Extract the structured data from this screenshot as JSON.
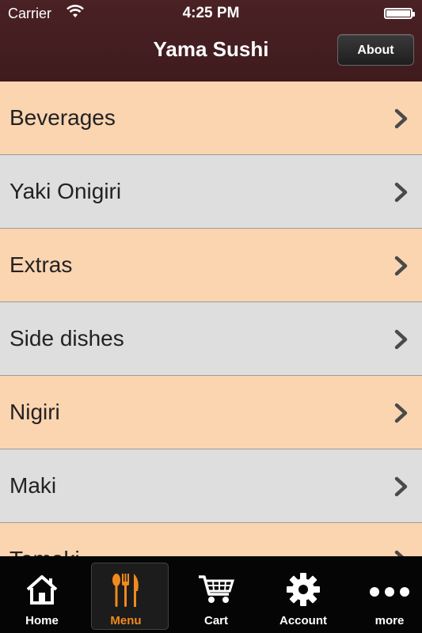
{
  "status": {
    "carrier": "Carrier",
    "time": "4:25 PM"
  },
  "nav": {
    "title": "Yama Sushi",
    "about_label": "About"
  },
  "colors": {
    "header": "#4a2124",
    "peach": "#fbd4b0",
    "gray": "#dedede",
    "accent": "#f08a1d"
  },
  "menu": {
    "items": [
      {
        "label": "Beverages"
      },
      {
        "label": "Yaki Onigiri"
      },
      {
        "label": "Extras"
      },
      {
        "label": "Side dishes"
      },
      {
        "label": "Nigiri"
      },
      {
        "label": "Maki"
      },
      {
        "label": "Temaki"
      }
    ]
  },
  "tabbar": {
    "tabs": [
      {
        "label": "Home",
        "icon": "home-icon"
      },
      {
        "label": "Menu",
        "icon": "cutlery-icon",
        "active": true
      },
      {
        "label": "Cart",
        "icon": "cart-icon"
      },
      {
        "label": "Account",
        "icon": "gear-icon"
      },
      {
        "label": "more",
        "icon": "more-icon"
      }
    ]
  }
}
